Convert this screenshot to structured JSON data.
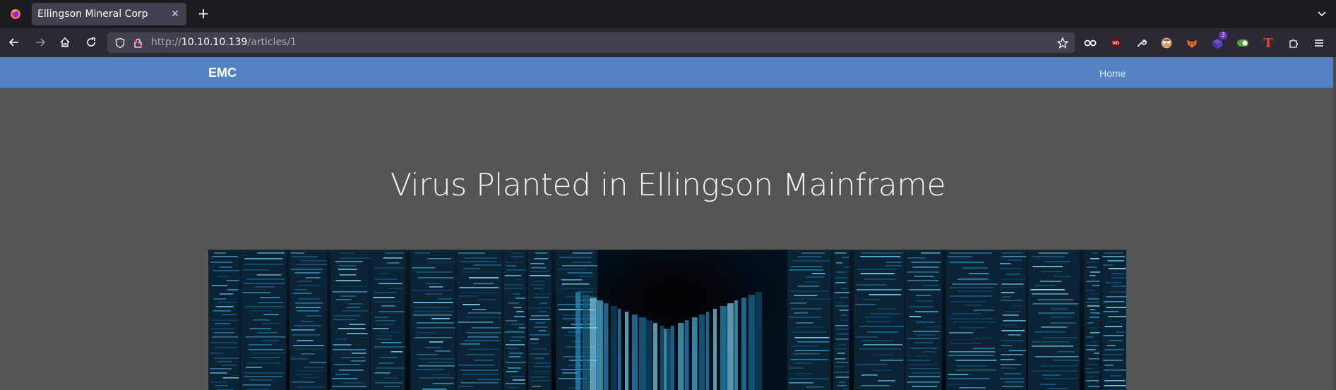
{
  "browser": {
    "tab": {
      "title": "Ellingson Mineral Corp"
    },
    "url": {
      "scheme": "http://",
      "host": "10.10.10.139",
      "path": "/articles/1"
    },
    "extensions": [
      {
        "name": "incognito-mask-icon"
      },
      {
        "name": "ublock-icon",
        "label": "UD"
      },
      {
        "name": "wrench-icon"
      },
      {
        "name": "face-extension-icon"
      },
      {
        "name": "fox-extension-icon"
      },
      {
        "name": "cube-extension-icon",
        "badge": "3"
      },
      {
        "name": "toggle-extension-icon"
      },
      {
        "name": "text-t-icon",
        "label": "T"
      },
      {
        "name": "puzzle-icon"
      },
      {
        "name": "hamburger-menu-icon"
      }
    ]
  },
  "site": {
    "brand": "EMC",
    "nav": {
      "home": "Home"
    },
    "article": {
      "title": "Virus Planted in Ellingson Mainframe"
    }
  },
  "colors": {
    "nav_background": "#5383c2",
    "page_background": "#555555",
    "browser_chrome": "#1c1b22"
  }
}
